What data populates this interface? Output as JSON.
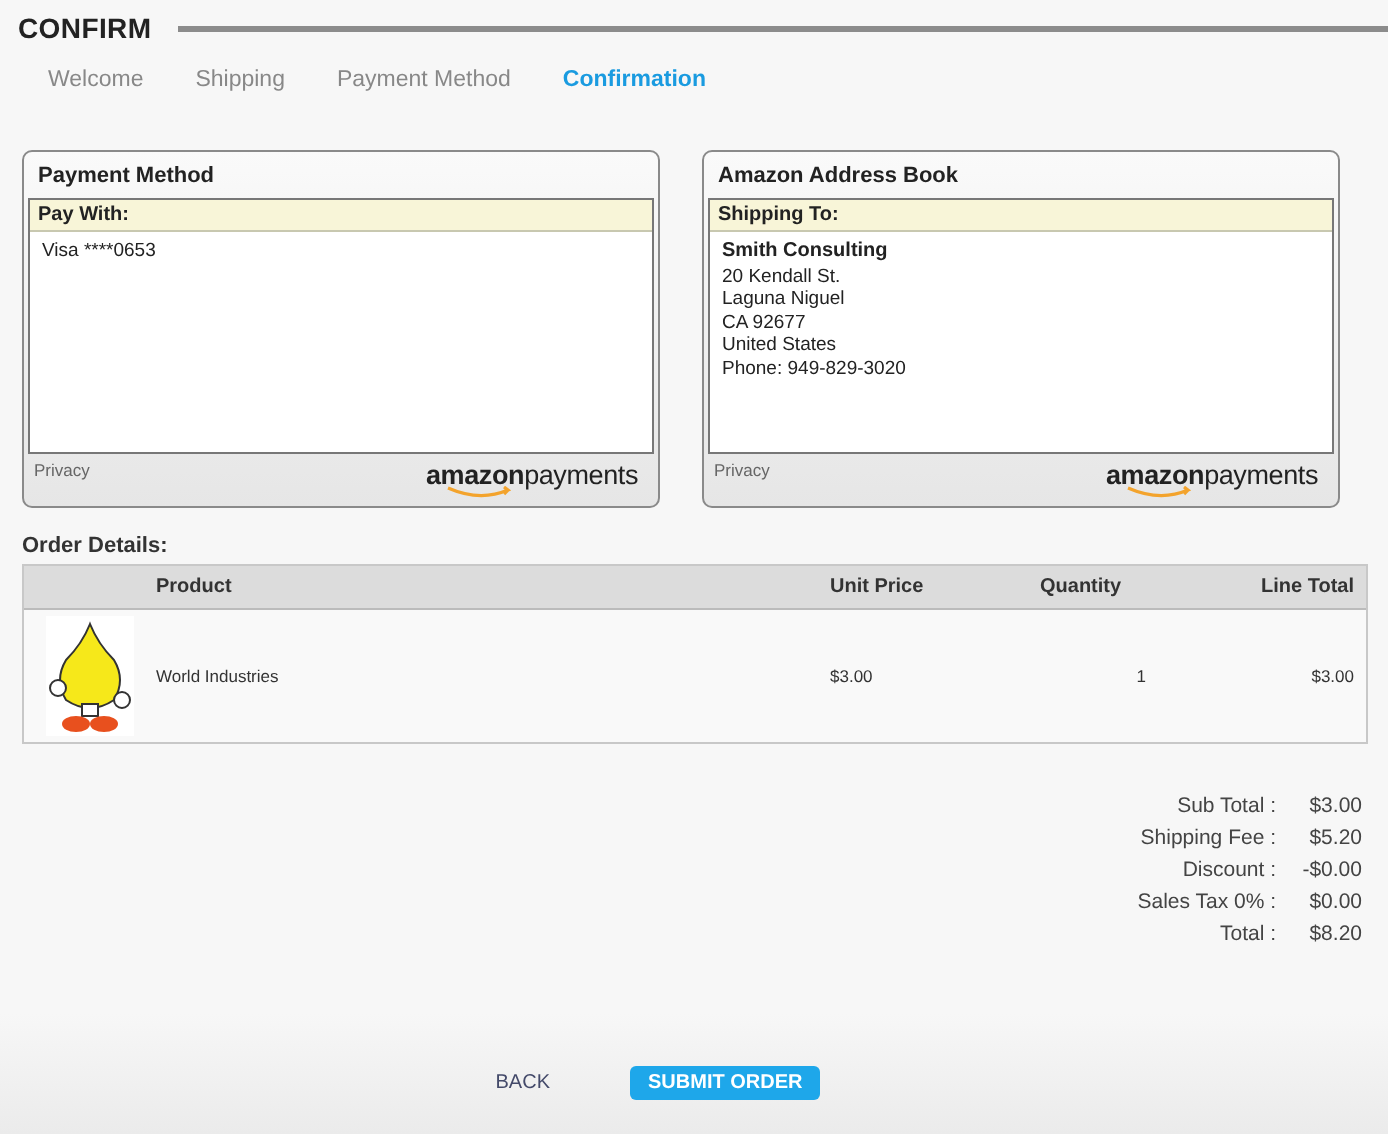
{
  "header": {
    "title": "CONFIRM"
  },
  "steps": [
    {
      "label": "Welcome",
      "selected": false
    },
    {
      "label": "Shipping",
      "selected": false
    },
    {
      "label": "Payment Method",
      "selected": false
    },
    {
      "label": "Confirmation",
      "selected": true
    }
  ],
  "panels": [
    {
      "title": "Payment Method",
      "subheader": "Pay With:",
      "lines": [
        {
          "kind": "plain",
          "text": "Visa ****0653"
        }
      ],
      "footer_link": "Privacy",
      "logo": "**amazon**payments"
    },
    {
      "title": "Amazon Address Book",
      "subheader": "Shipping To:",
      "lines": [
        {
          "kind": "name",
          "text": "Smith Consulting"
        },
        {
          "kind": "plain",
          "text": "20 Kendall St."
        },
        {
          "kind": "plain",
          "text": "Laguna Niguel"
        },
        {
          "kind": "plain",
          "text": "CA 92677"
        },
        {
          "kind": "plain",
          "text": "United States"
        },
        {
          "kind": "plain",
          "text": "Phone: 949-829-3020"
        }
      ],
      "footer_link": "Privacy",
      "logo": "**amazon**payments"
    }
  ],
  "order": {
    "title": "Order Details:",
    "columns": [
      "Product",
      "Unit Price",
      "Quantity",
      "Line Total"
    ],
    "rows": [
      {
        "product": "World Industries",
        "unit_price": "$3.00",
        "quantity": "1",
        "line_total": "$3.00"
      }
    ]
  },
  "totals": [
    {
      "label": "Sub Total :",
      "value": "$3.00"
    },
    {
      "label": "Shipping Fee :",
      "value": "$5.20"
    },
    {
      "label": "Discount :",
      "value": "-$0.00"
    },
    {
      "label": "Sales Tax 0% :",
      "value": "$0.00"
    },
    {
      "label": "Total :",
      "value": "$8.20"
    }
  ],
  "buttons": [
    {
      "kind": "link",
      "label": "BACK"
    },
    {
      "kind": "primary",
      "label": "SUBMIT ORDER"
    }
  ]
}
